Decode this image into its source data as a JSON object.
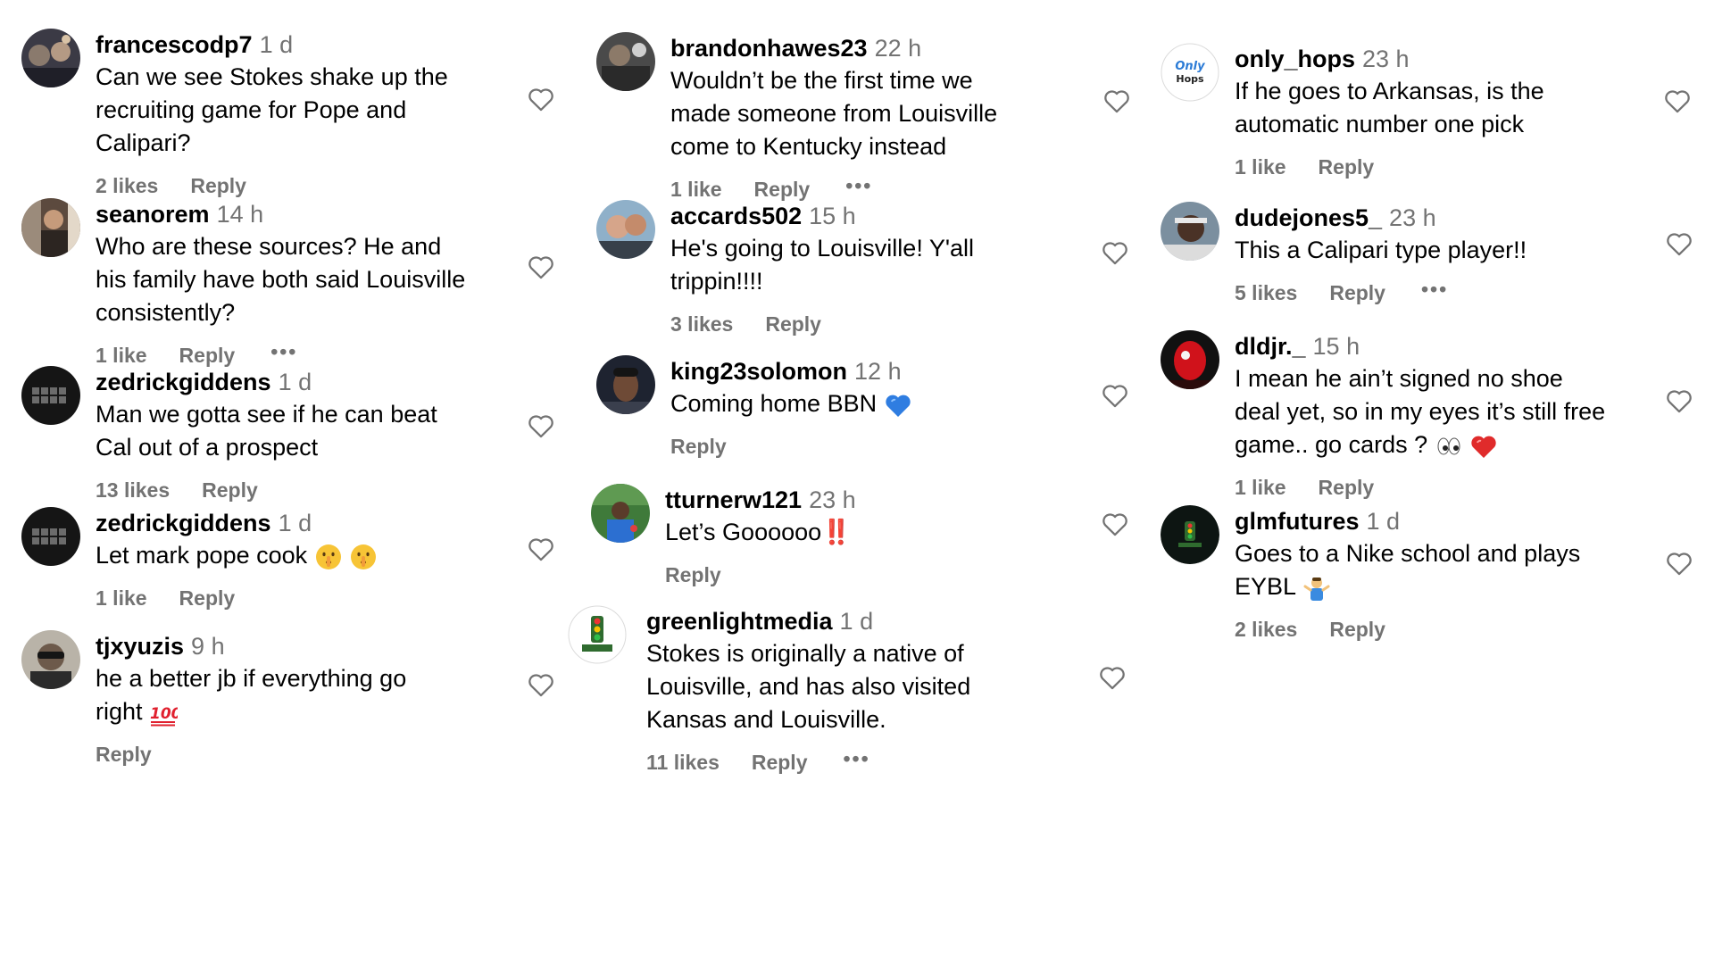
{
  "columns": [
    {
      "comments": [
        {
          "username": "francescodp7",
          "time": "1 d",
          "lines": [
            "Can we see Stokes shake up the",
            "recruiting game for Pope and",
            "Calipari?"
          ],
          "likes": "2 likes",
          "reply": "Reply"
        },
        {
          "username": "seanorem",
          "time": "14 h",
          "lines": [
            "Who are these sources? He and",
            "his family have both said Louisville",
            "consistently?"
          ],
          "likes": "1 like",
          "reply": "Reply",
          "more": "•••"
        },
        {
          "username": "zedrickgiddens",
          "time": "1 d",
          "lines": [
            "Man we gotta see if he can beat",
            "Cal out of a prospect"
          ],
          "likes": "13 likes",
          "reply": "Reply"
        },
        {
          "username": "zedrickgiddens",
          "time": "1 d",
          "lines": [
            "Let mark pope cook"
          ],
          "likes": "1 like",
          "reply": "Reply",
          "emojis": [
            "shushing-face-emoji",
            "shushing-face-emoji"
          ]
        },
        {
          "username": "tjxyuzis",
          "time": "9 h",
          "lines": [
            "he a better jb if everything go",
            "right"
          ],
          "reply": "Reply",
          "emojis": [
            "hundred-points-emoji"
          ]
        }
      ]
    },
    {
      "comments": [
        {
          "username": "brandonhawes23",
          "time": "22 h",
          "lines": [
            "Wouldn’t be the first time we",
            "made someone from Louisville",
            "come to Kentucky instead"
          ],
          "likes": "1 like",
          "reply": "Reply",
          "more": "•••"
        },
        {
          "username": "accards502",
          "time": "15 h",
          "lines": [
            "He's going to Louisville! Y'all",
            "trippin!!!!"
          ],
          "likes": "3 likes",
          "reply": "Reply"
        },
        {
          "username": "king23solomon",
          "time": "12 h",
          "lines": [
            "Coming home BBN"
          ],
          "reply": "Reply",
          "emojis": [
            "blue-heart-emoji"
          ]
        },
        {
          "username": "tturnerw121",
          "time": "23 h",
          "lines": [
            "Let’s Goooooo"
          ],
          "reply": "Reply",
          "emoji_text": "‼️"
        },
        {
          "username": "greenlightmedia",
          "time": "1 d",
          "lines": [
            "Stokes is originally a native of",
            "Louisville, and has also visited",
            "Kansas and Louisville."
          ],
          "likes": "11 likes",
          "reply": "Reply",
          "more": "•••"
        }
      ]
    },
    {
      "comments": [
        {
          "username": "only_hops",
          "time": "23 h",
          "lines": [
            "If he goes to Arkansas, is the",
            "automatic number one pick"
          ],
          "likes": "1 like",
          "reply": "Reply",
          "avatar_text": "Only Hops"
        },
        {
          "username": "dudejones5_",
          "time": "23 h",
          "lines": [
            "This a Calipari type player!!"
          ],
          "likes": "5 likes",
          "reply": "Reply",
          "more": "•••"
        },
        {
          "username": "dldjr._",
          "time": "15 h",
          "lines": [
            "I mean he ain’t signed no shoe",
            "deal yet, so in my eyes it’s still free",
            "game.. go cards ?"
          ],
          "likes": "1 like",
          "reply": "Reply",
          "emojis": [
            "eyes-emoji",
            "red-heart-emoji"
          ]
        },
        {
          "username": "glmfutures",
          "time": "1 d",
          "lines": [
            "Goes to a Nike school and plays",
            "EYBL"
          ],
          "likes": "2 likes",
          "reply": "Reply",
          "emojis": [
            "shrugging-person-emoji"
          ]
        }
      ]
    }
  ]
}
